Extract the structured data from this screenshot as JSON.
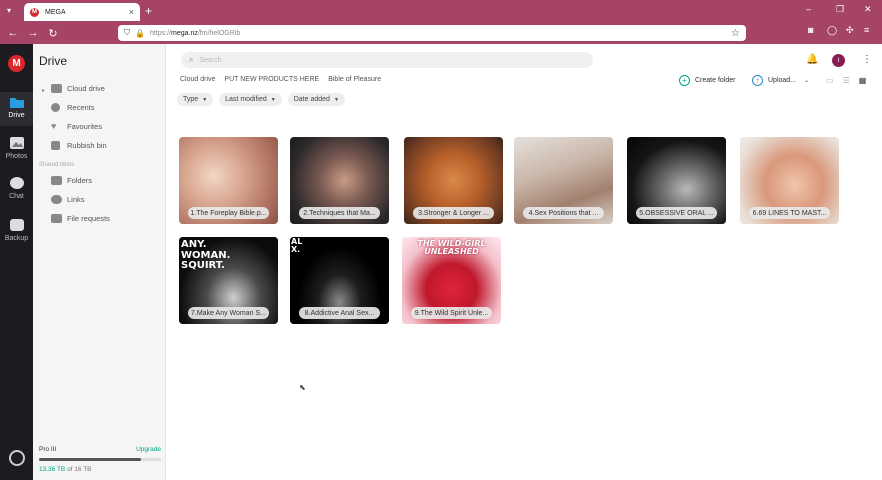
{
  "browser": {
    "tab_title": "MEGA",
    "favicon_letter": "M",
    "url_prefix": "https://",
    "url_host": "mega.nz",
    "url_path": "/fm/helOGRib"
  },
  "rail": {
    "logo_letter": "M",
    "items": [
      {
        "label": "Drive",
        "icon": "folder-icon",
        "active": true
      },
      {
        "label": "Photos",
        "icon": "photos-icon",
        "active": false
      },
      {
        "label": "Chat",
        "icon": "chat-icon",
        "active": false
      },
      {
        "label": "Backup",
        "icon": "backup-icon",
        "active": false
      }
    ]
  },
  "sidebar": {
    "title": "Drive",
    "items": [
      {
        "label": "Cloud drive",
        "icon": "cloud-icon"
      },
      {
        "label": "Recents",
        "icon": "clock-icon"
      },
      {
        "label": "Favourites",
        "icon": "heart-icon"
      },
      {
        "label": "Rubbish bin",
        "icon": "trash-icon"
      }
    ],
    "shared_section": "Shared items",
    "shared_items": [
      {
        "label": "Folders",
        "icon": "shared-folder-icon"
      },
      {
        "label": "Links",
        "icon": "link-icon"
      },
      {
        "label": "File requests",
        "icon": "file-request-icon"
      }
    ],
    "plan": {
      "name": "Pro III",
      "upgrade_label": "Upgrade",
      "used": "13.36 TB",
      "usage_suffix": " of 16 TB",
      "usage_fraction": 0.835
    }
  },
  "header": {
    "search_placeholder": "Search",
    "avatar_letter": "I"
  },
  "breadcrumb": [
    "Cloud drive",
    "PUT NEW PRODUCTS HERE",
    "Bible of Pleasure"
  ],
  "actions": {
    "create_folder": "Create folder",
    "upload": "Upload..."
  },
  "filters": [
    "Type",
    "Last modified",
    "Date added"
  ],
  "files": [
    {
      "label": "1.The Foreplay Bible.p...",
      "thumb_text": ""
    },
    {
      "label": "2.Techniques that Ma...",
      "thumb_text": ""
    },
    {
      "label": "3.Stronger & Longer ...",
      "thumb_text": ""
    },
    {
      "label": "4.Sex Positions that ...",
      "thumb_text": ""
    },
    {
      "label": "5.OBSESSIVE ORAL ...",
      "thumb_text": ""
    },
    {
      "label": "6.69 LINES TO MAST...",
      "thumb_text": ""
    },
    {
      "label": "7.Make Any Woman S...",
      "thumb_text": "ANY.\nWOMAN.\nSQUIRT."
    },
    {
      "label": "8.Addictive Anal Sex...",
      "thumb_text": "AL\nX."
    },
    {
      "label": "9.The Wild Spirit Unle...",
      "thumb_text": "THE WILD-GIRL\nUNLEASHED"
    }
  ]
}
